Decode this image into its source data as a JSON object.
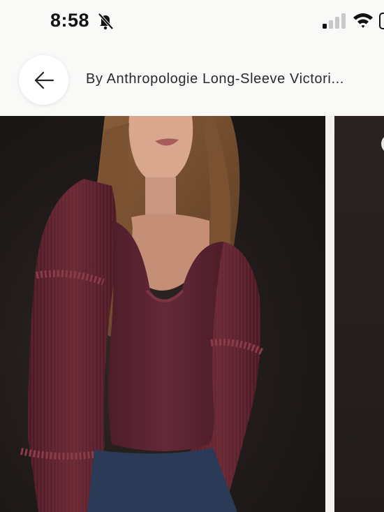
{
  "status_bar": {
    "time": "8:58",
    "icons": [
      "bell-slash-icon",
      "cellular-signal-icon",
      "wifi-icon",
      "battery-icon"
    ]
  },
  "header": {
    "back_icon": "arrow-left-icon",
    "title": "By Anthropologie Long-Sleeve Victori..."
  },
  "gallery": {
    "images": [
      {
        "subject": "product-photo-burgundy-top"
      },
      {
        "subject": "product-photo-next"
      }
    ]
  },
  "colors": {
    "background": "#f9f9f7",
    "photo_backdrop": "#1f1a19",
    "top_color": "#5e2531",
    "jeans_color": "#2b3a57",
    "hair_color": "#7a5232"
  }
}
